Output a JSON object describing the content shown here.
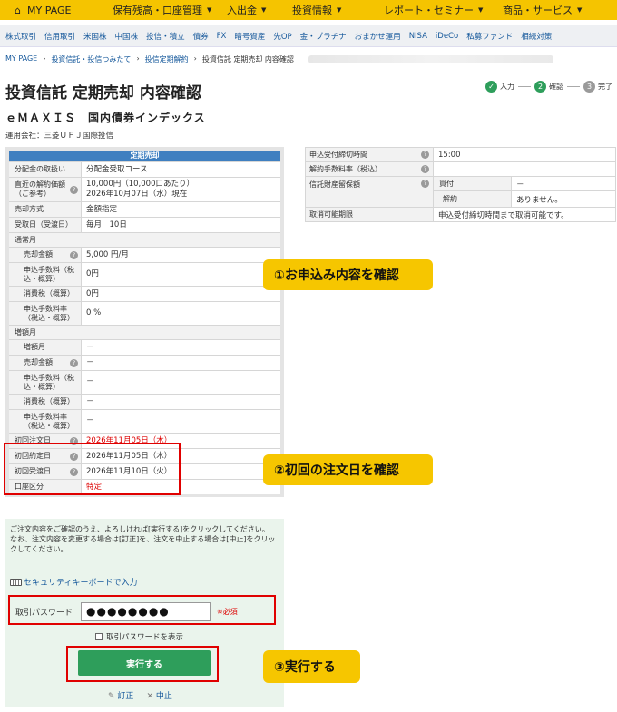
{
  "topnav": {
    "home_icon": "home-icon",
    "items": [
      "MY PAGE",
      "保有残高・口座管理",
      "入出金",
      "投資情報",
      "レポート・セミナー",
      "商品・サービス"
    ]
  },
  "subnav": {
    "items": [
      "株式取引",
      "信用取引",
      "米国株",
      "中国株",
      "投信・積立",
      "債券",
      "FX",
      "暗号資産",
      "先OP",
      "金・プラチナ",
      "おまかせ運用",
      "NISA",
      "iDeCo",
      "私募ファンド",
      "相続対策"
    ]
  },
  "breadcrumb": {
    "items": [
      "MY PAGE",
      "投資信託・投信つみたて",
      "投信定期解約",
      "投資信託 定期売却 内容確認"
    ]
  },
  "page": {
    "title": "投資信託 定期売却 内容確認",
    "fund_name": "ｅＭＡＸＩＳ　国内債券インデックス",
    "manager": "運用会社：三菱ＵＦＪ国際投信"
  },
  "steps": [
    {
      "num": "✓",
      "label": "入力",
      "color": "#2e9e5b"
    },
    {
      "num": "2",
      "label": "確認",
      "color": "#2e9e5b"
    },
    {
      "num": "3",
      "label": "完了",
      "color": "#9a9a9a"
    }
  ],
  "left_table": {
    "header": "定期売却",
    "dist_label": "分配金の取扱い",
    "dist_value": "分配金受取コース",
    "nav_label": "直近の解約価額（ご参考）",
    "nav_value1": "10,000円（10,000口あたり）",
    "nav_value2": "2026年10月07日（水）現在",
    "method_label": "売却方式",
    "method_value": "金額指定",
    "recv_label": "受取日（受渡日）",
    "recv_value": "毎月　10日",
    "normal_label": "通常月",
    "amount_label": "売却金額",
    "amount_value": "5,000 円/月",
    "fee_label": "申込手数料（税込・概算）",
    "fee_value": "0円",
    "tax_label": "消費税（概算）",
    "tax_value": "0円",
    "rate_label": "申込手数料率（税込・概算）",
    "rate_value": "0 %",
    "inc_label": "増額月",
    "incmonth_label": "増額月",
    "incmonth_value": "－",
    "incamount_label": "売却金額",
    "incamount_value": "－",
    "incfee_label": "申込手数料（税込・概算）",
    "incfee_value": "－",
    "inctax_label": "消費税（概算）",
    "inctax_value": "－",
    "incrate_label": "申込手数料率（税込・概算）",
    "incrate_value": "－",
    "first_order_label": "初回注文日",
    "first_order_value": "2026年11月05日（木）",
    "first_exec_label": "初回約定日",
    "first_exec_value": "2026年11月05日（木）",
    "first_settle_label": "初回受渡日",
    "first_settle_value": "2026年11月10日（火）",
    "account_label": "口座区分",
    "account_value": "特定"
  },
  "right_table": {
    "cutoff_label": "申込受付締切時間",
    "cutoff_value": "15:00",
    "cancelfee_label": "解約手数料率（税込）",
    "cancelfee_value": "",
    "reserve_label": "信託財産留保額",
    "buy_label": "買付",
    "buy_value": "－",
    "sell_label": "解約",
    "sell_value": "ありません。",
    "cancel_label": "取消可能期限",
    "cancel_value": "申込受付締切時間まで取消可能です。"
  },
  "confirm": {
    "message": "ご注文内容をご確認のうえ、よろしければ[実行する]をクリックしてください。\nなお、注文内容を変更する場合は[訂正]を、注文を中止する場合は[中止]をクリックしてください。",
    "keyboard_label": "セキュリティキーボードで入力",
    "password_label": "取引パスワード",
    "password_value": "●●●●●●●●",
    "required": "※必須",
    "show_password": "取引パスワードを表示",
    "execute": "実行する",
    "correct": "訂正",
    "cancel": "中止"
  },
  "callouts": {
    "c1": "①お申込み内容を確認",
    "c2": "②初回の注文日を確認",
    "c3": "③実行する"
  }
}
